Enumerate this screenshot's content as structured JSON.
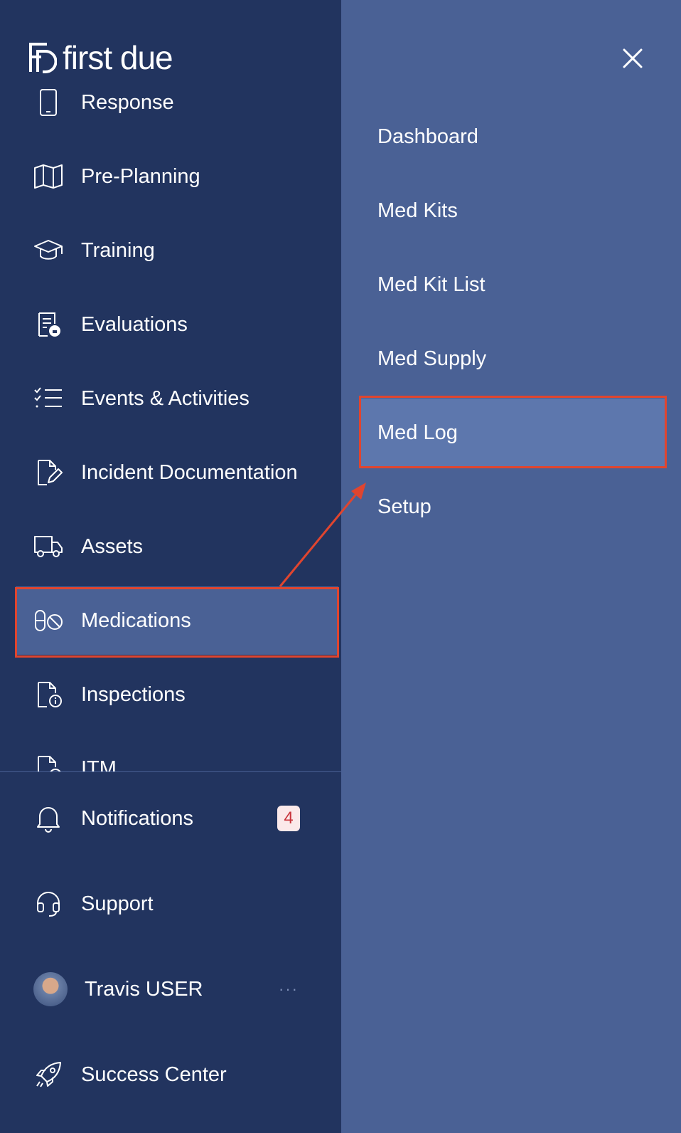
{
  "brand": {
    "logo_text": "first due"
  },
  "nav": {
    "items": [
      {
        "label": "Response",
        "icon": "phone-icon"
      },
      {
        "label": "Pre-Planning",
        "icon": "map-icon"
      },
      {
        "label": "Training",
        "icon": "graduation-cap-icon"
      },
      {
        "label": "Evaluations",
        "icon": "evaluation-doc-icon"
      },
      {
        "label": "Events & Activities",
        "icon": "checklist-icon"
      },
      {
        "label": "Incident Documentation",
        "icon": "document-edit-icon"
      },
      {
        "label": "Assets",
        "icon": "truck-icon"
      },
      {
        "label": "Medications",
        "icon": "pill-icon",
        "active": true
      },
      {
        "label": "Inspections",
        "icon": "inspection-doc-icon"
      },
      {
        "label": "ITM",
        "icon": "itm-doc-icon"
      }
    ]
  },
  "footer": {
    "notifications": {
      "label": "Notifications",
      "badge": "4"
    },
    "support": {
      "label": "Support"
    },
    "user": {
      "name": "Travis USER",
      "more": "···"
    },
    "success_center": {
      "label": "Success Center"
    }
  },
  "submenu": {
    "items": [
      {
        "label": "Dashboard"
      },
      {
        "label": "Med Kits"
      },
      {
        "label": "Med Kit List"
      },
      {
        "label": "Med Supply"
      },
      {
        "label": "Med Log",
        "active": true
      },
      {
        "label": "Setup"
      }
    ]
  },
  "colors": {
    "sidebar_bg": "#22345f",
    "panel_bg": "#4a6195",
    "active_bg": "#5d77ad",
    "highlight": "#e0452f",
    "badge_bg": "#fbe9ea",
    "badge_text": "#c8333b"
  }
}
